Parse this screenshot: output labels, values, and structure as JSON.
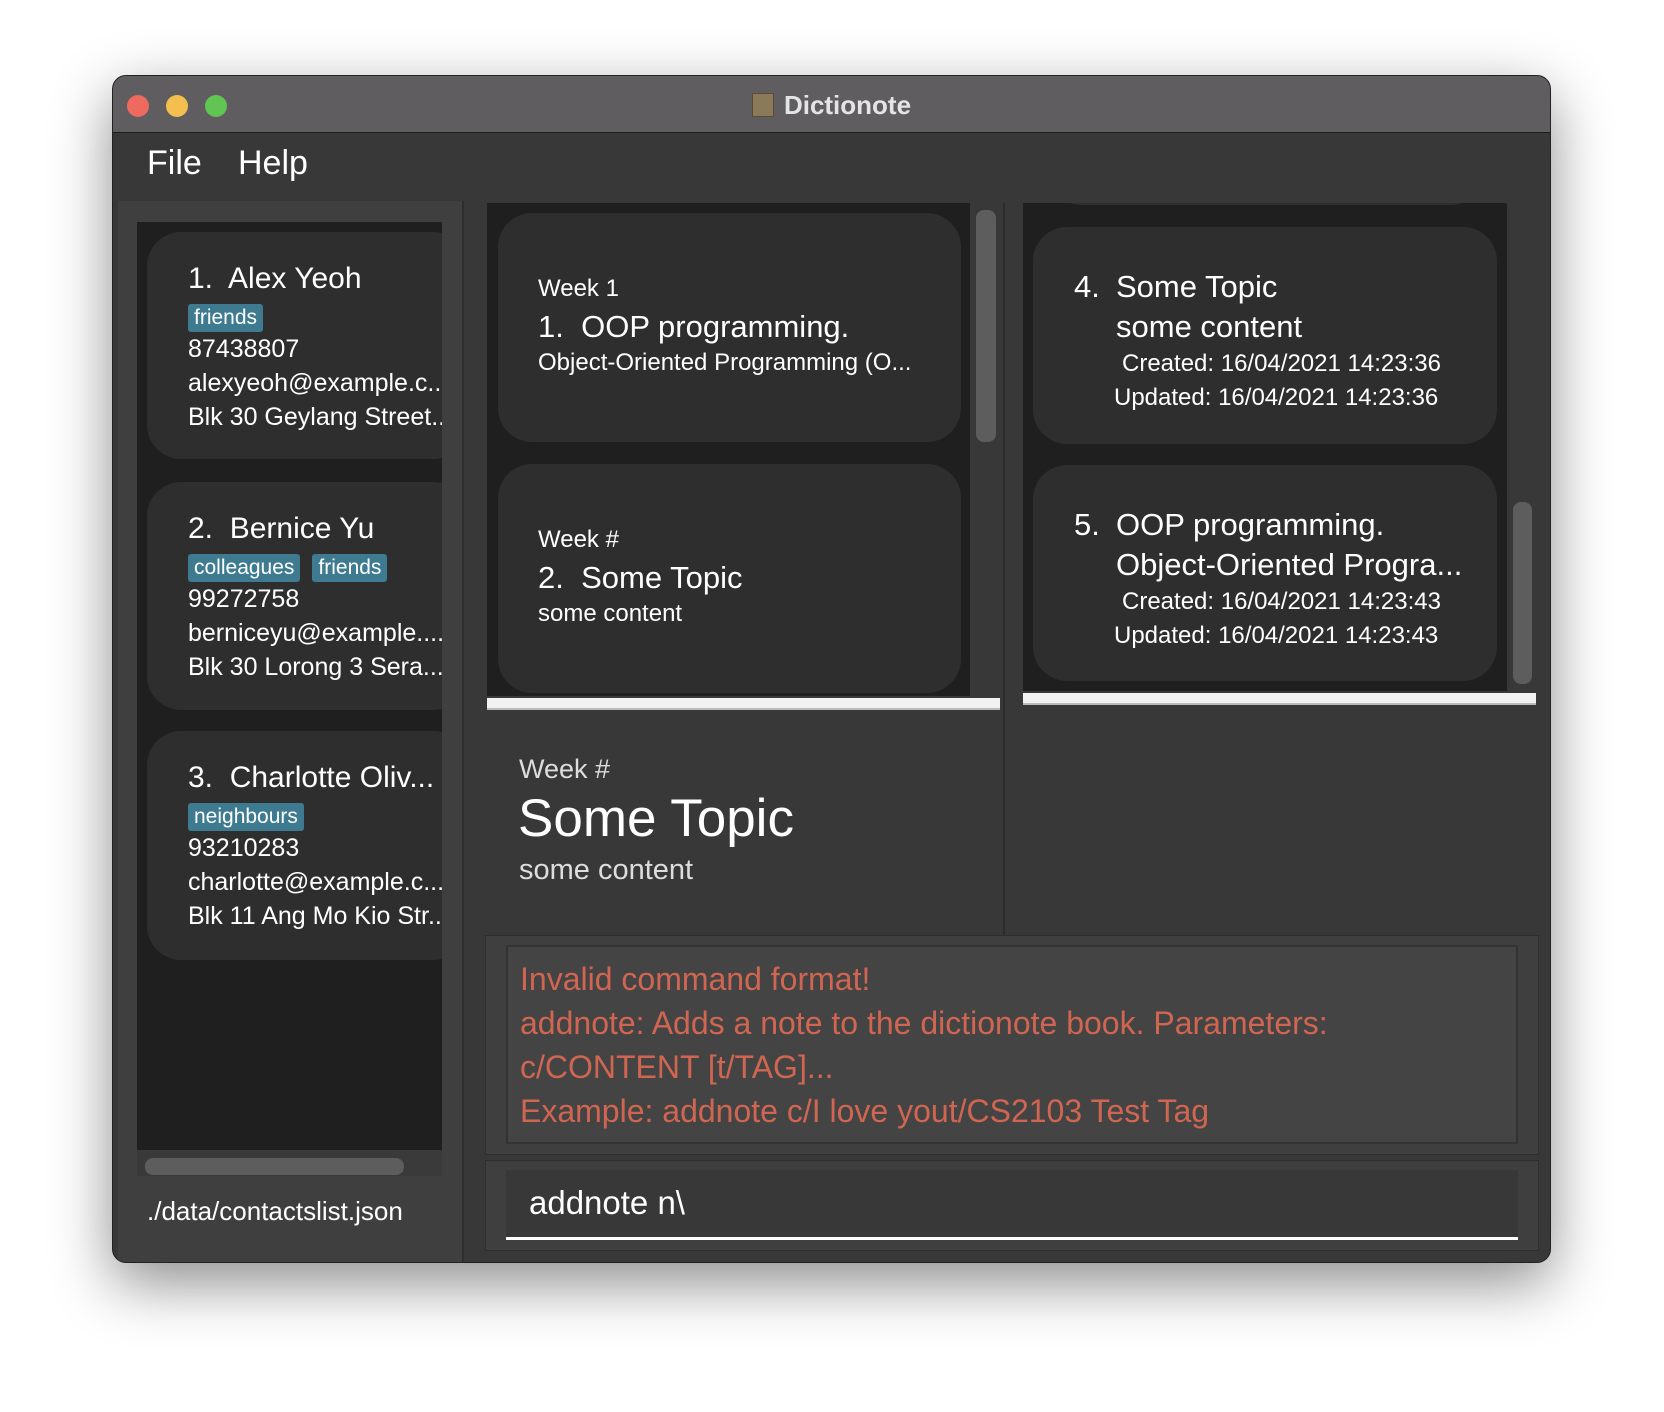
{
  "window": {
    "title": "Dictionote",
    "colors": {
      "close": "#ee6a5f",
      "minimize": "#f5bf4f",
      "zoom": "#61c554"
    }
  },
  "menu": {
    "items": [
      "File",
      "Help"
    ]
  },
  "contacts": [
    {
      "index": "1.",
      "name": "Alex Yeoh",
      "tags": [
        "friends"
      ],
      "phone": "87438807",
      "email": "alexyeoh@example.c...",
      "address": "Blk 30 Geylang Street..."
    },
    {
      "index": "2.",
      "name": "Bernice Yu",
      "tags": [
        "colleagues",
        "friends"
      ],
      "phone": "99272758",
      "email": "berniceyu@example....",
      "address": "Blk 30 Lorong 3 Sera..."
    },
    {
      "index": "3.",
      "name": "Charlotte Oliv...",
      "tags": [
        "neighbours"
      ],
      "phone": "93210283",
      "email": "charlotte@example.c...",
      "address": "Blk 11 Ang Mo Kio Str..."
    }
  ],
  "status_path": "./data/contactslist.json",
  "contents": [
    {
      "week": "Week 1",
      "index": "1.",
      "title": "OOP programming.",
      "text": "Object-Oriented Programming (O..."
    },
    {
      "week": "Week #",
      "index": "2.",
      "title": "Some Topic",
      "text": "some content"
    }
  ],
  "notes": [
    {
      "index": "4.",
      "title": "Some Topic",
      "text": "some content",
      "created": "Created: 16/04/2021 14:23:36",
      "updated": "Updated: 16/04/2021 14:23:36"
    },
    {
      "index": "5.",
      "title": "OOP programming.",
      "text": "Object-Oriented Progra...",
      "created": "Created: 16/04/2021 14:23:43",
      "updated": "Updated: 16/04/2021 14:23:43"
    }
  ],
  "detail": {
    "week": "Week #",
    "title": "Some Topic",
    "text": "some content"
  },
  "result": {
    "lines": [
      "Invalid command format!",
      "addnote: Adds a note to the dictionote book. Parameters:",
      "c/CONTENT [t/TAG]...",
      "Example: addnote c/I love yout/CS2103 Test Tag"
    ],
    "color": "#d06651"
  },
  "command": {
    "value": "addnote n\\"
  }
}
